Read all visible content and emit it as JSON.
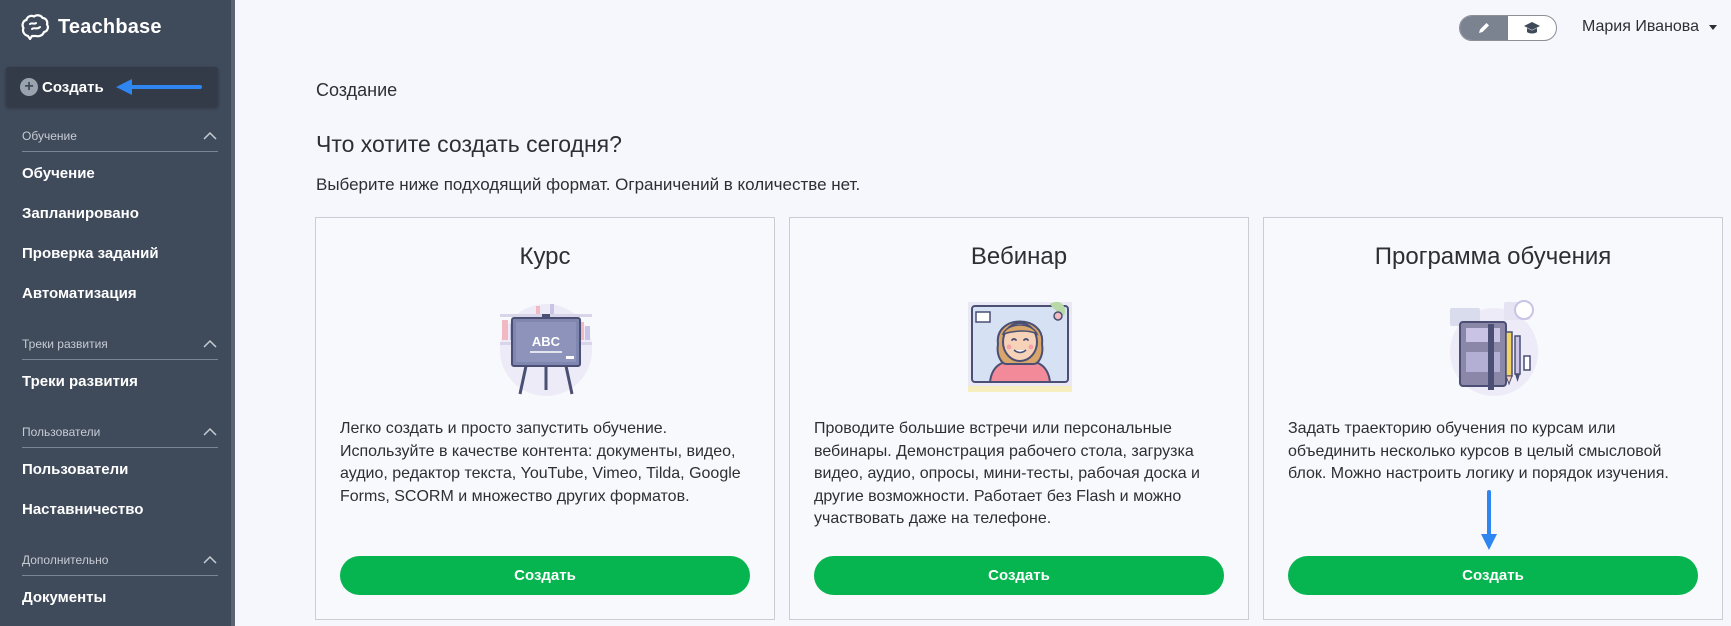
{
  "app": {
    "brand_name": "Teachbase"
  },
  "sidebar": {
    "create_label": "Создать",
    "sections": [
      {
        "title": "Обучение",
        "items": [
          "Обучение",
          "Запланировано",
          "Проверка заданий",
          "Автоматизация"
        ]
      },
      {
        "title": "Треки развития",
        "items": [
          "Треки развития"
        ]
      },
      {
        "title": "Пользователи",
        "items": [
          "Пользователи",
          "Наставничество"
        ]
      },
      {
        "title": "Дополнительно",
        "items": [
          "Документы"
        ]
      }
    ]
  },
  "header": {
    "mode_toggle": {
      "active": "edit",
      "icons": [
        "pencil-icon",
        "graduation-cap-icon"
      ]
    },
    "user_name": "Мария Иванова"
  },
  "main": {
    "breadcrumb": "Создание",
    "title": "Что хотите создать сегодня?",
    "subtitle": "Выберите ниже подходящий формат. Ограничений в количестве нет.",
    "cards": [
      {
        "title": "Курс",
        "icon": "blackboard-abc-illustration",
        "board_text": "ABC",
        "description": "Легко создать и просто запустить обучение. Используйте в качестве контента: документы, видео, аудио, редактор текста, YouTube, Vimeo, Tilda, Google Forms, SCORM и множество других форматов.",
        "button": "Создать"
      },
      {
        "title": "Вебинар",
        "icon": "webinar-person-illustration",
        "description": "Проводите большие встречи или персональные вебинары. Демонстрация рабочего стола, загрузка видео, аудио, опросы, мини-тесты, рабочая доска и другие возможности. Работает без Flash и можно участвовать даже на телефоне.",
        "button": "Создать"
      },
      {
        "title": "Программа обучения",
        "icon": "notebook-pencils-illustration",
        "description": "Задать траекторию обучения по курсам или объединить несколько курсов в целый смысловой блок. Можно настроить логику и порядок изучения.",
        "button": "Создать"
      }
    ]
  },
  "colors": {
    "sidebar": "#3f4a5a",
    "accent_green": "#06b54f",
    "annotation_arrow": "#2f86f0",
    "background": "#f5f7fc"
  }
}
